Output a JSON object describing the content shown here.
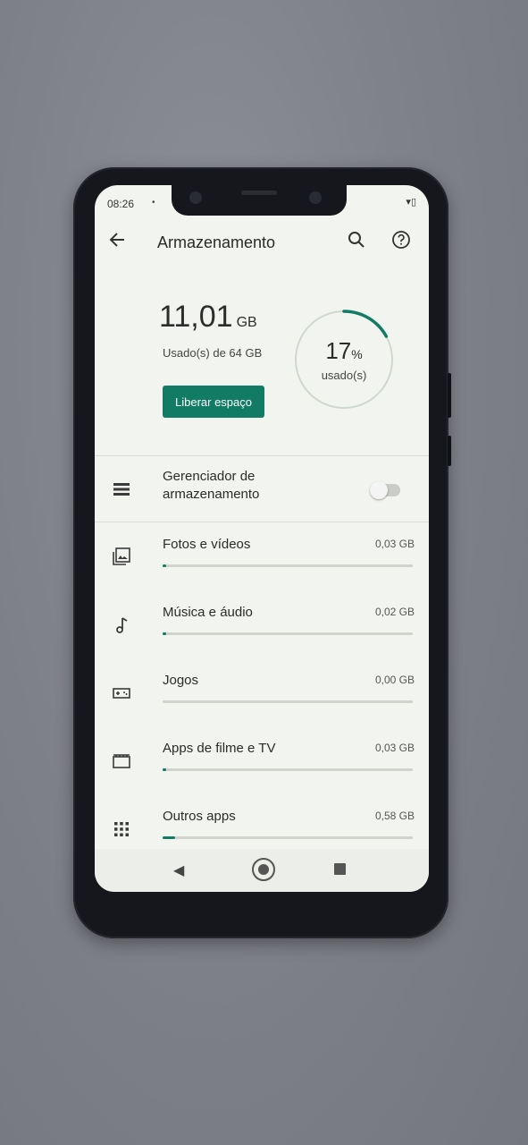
{
  "status_bar": {
    "time": "08:26",
    "dot": "•",
    "icons": "▾▯"
  },
  "app_bar": {
    "back_icon": "arrow-left",
    "title": "Armazenamento",
    "search_icon": "search",
    "help_icon": "help-circle"
  },
  "summary": {
    "used_value": "11,01",
    "used_unit": "GB",
    "used_of": "Usado(s) de 64 GB",
    "free_button": "Liberar espaço",
    "percent_value": "17",
    "percent_sign": "%",
    "percent_label": "usado(s)",
    "percent_fraction": 0.17
  },
  "manager": {
    "label_line1": "Gerenciador de",
    "label_line2": "armazenamento",
    "enabled": false
  },
  "categories": [
    {
      "label": "Fotos e vídeos",
      "value": "0,03 GB",
      "icon": "photo-icon",
      "fill": 0.01
    },
    {
      "label": "Música e áudio",
      "value": "0,02 GB",
      "icon": "music-note-icon",
      "fill": 0.01
    },
    {
      "label": "Jogos",
      "value": "0,00 GB",
      "icon": "gamepad-icon",
      "fill": 0.0
    },
    {
      "label": "Apps de filme e TV",
      "value": "0,03 GB",
      "icon": "movie-icon",
      "fill": 0.01
    },
    {
      "label": "Outros apps",
      "value": "0,58 GB",
      "icon": "apps-grid-icon",
      "fill": 0.05
    }
  ],
  "colors": {
    "accent": "#127b63",
    "screen_bg": "#f2f5ef",
    "track": "#cfd3cc"
  }
}
